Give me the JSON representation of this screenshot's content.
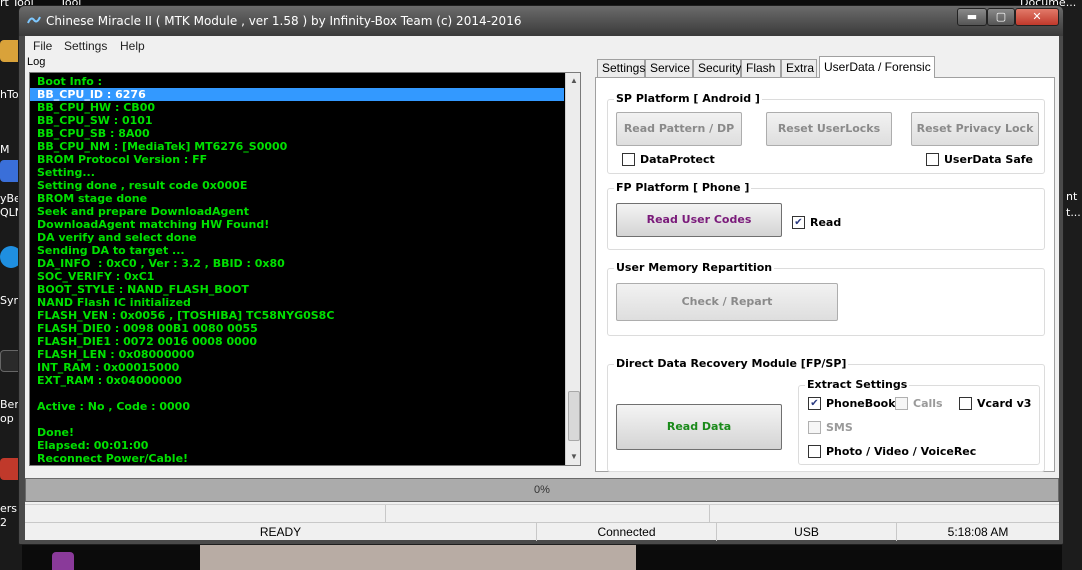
{
  "desktop": {
    "top_labels": [
      "rt Tool",
      "Tool",
      "Docume..."
    ],
    "left_labels": [
      "hTo",
      "M",
      "yBe",
      "QLN",
      "Syn",
      "Ber",
      "op",
      "ersM",
      "2"
    ],
    "right_labels": [
      "nt",
      "t..."
    ]
  },
  "window": {
    "title": "Chinese Miracle II ( MTK Module , ver 1.58 ) by Infinity-Box Team (c) 2014-2016",
    "min_label": "▬",
    "max_label": "▢",
    "close_label": "✕"
  },
  "menu": {
    "items": [
      "File",
      "Settings",
      "Help"
    ]
  },
  "log": {
    "label": "Log",
    "selected_index": 1,
    "lines": [
      "Boot Info :",
      "BB_CPU_ID : 6276",
      "BB_CPU_HW : CB00",
      "BB_CPU_SW : 0101",
      "BB_CPU_SB : 8A00",
      "BB_CPU_NM : [MediaTek] MT6276_S0000",
      "BROM Protocol Version : FF",
      "Setting...",
      "Setting done , result code 0x000E",
      "BROM stage done",
      "Seek and prepare DownloadAgent",
      "DownloadAgent matching HW Found!",
      "DA verify and select done",
      "Sending DA to target ...",
      "DA_INFO  : 0xC0 , Ver : 3.2 , BBID : 0x80",
      "SOC_VERIFY : 0xC1",
      "BOOT_STYLE : NAND_FLASH_BOOT",
      "NAND Flash IC initialized",
      "FLASH_VEN : 0x0056 , [TOSHIBA] TC58NYG0S8C",
      "FLASH_DIE0 : 0098 00B1 0080 0055",
      "FLASH_DIE1 : 0072 0016 0008 0000",
      "FLASH_LEN : 0x08000000",
      "INT_RAM : 0x00015000",
      "EXT_RAM : 0x04000000",
      "",
      "Active : No , Code : 0000",
      "",
      "Done!",
      "Elapsed: 00:01:00",
      "Reconnect Power/Cable!"
    ]
  },
  "tabs": [
    {
      "label": "Settings",
      "active": false
    },
    {
      "label": "Service",
      "active": false
    },
    {
      "label": "Security",
      "active": false
    },
    {
      "label": "Flash",
      "active": false
    },
    {
      "label": "Extra",
      "active": false
    },
    {
      "label": "UserData / Forensic",
      "active": true
    }
  ],
  "sp_platform": {
    "title": "SP Platform [ Android ]",
    "read_pattern_label": "Read Pattern / DP",
    "reset_userlocks_label": "Reset UserLocks",
    "reset_privacy_label": "Reset Privacy Lock",
    "dataprotect_label": "DataProtect",
    "dataprotect_checked": false,
    "userdata_safe_label": "UserData Safe",
    "userdata_safe_checked": false
  },
  "fp_platform": {
    "title": "FP Platform [ Phone ]",
    "read_user_codes_label": "Read User Codes",
    "read_label": "Read",
    "read_checked": true
  },
  "user_memory": {
    "title": "User Memory Repartition",
    "check_repart_label": "Check / Repart"
  },
  "recovery": {
    "title": "Direct Data Recovery Module  [FP/SP]",
    "read_data_label": "Read Data",
    "extract_title": "Extract Settings",
    "phonebook_label": "PhoneBook",
    "phonebook_checked": true,
    "calls_label": "Calls",
    "calls_checked": false,
    "vcard_label": "Vcard v3",
    "vcard_checked": false,
    "sms_label": "SMS",
    "sms_checked": false,
    "photo_label": "Photo / Video / VoiceRec",
    "photo_checked": false
  },
  "progress": {
    "value": 0,
    "text": "0%"
  },
  "status": {
    "state": "READY",
    "connection": "Connected",
    "port": "USB",
    "time": "5:18:08 AM"
  },
  "colors": {
    "log_text": "#00e000",
    "log_selected": "#3399ff",
    "read_user_codes": "#7a1a7a",
    "read_data": "#1a8a1a"
  }
}
